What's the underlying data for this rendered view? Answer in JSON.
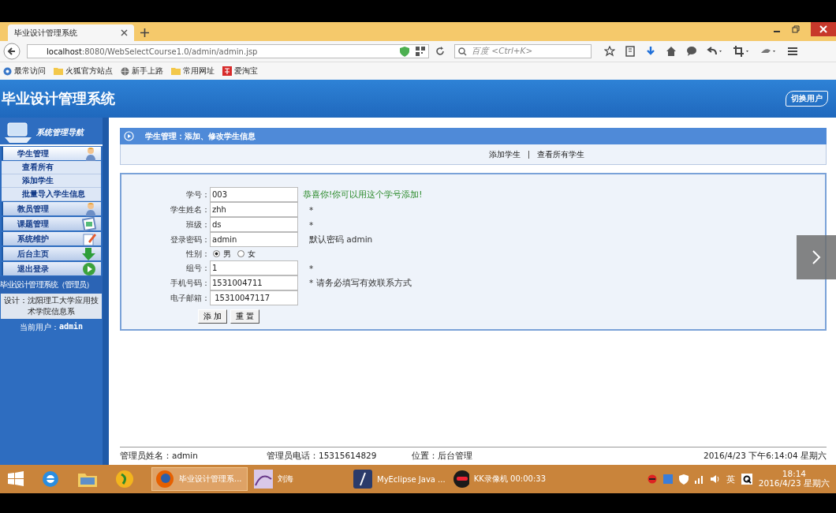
{
  "browser": {
    "tab_title": "毕业设计管理系统",
    "url_host": "localhost",
    "url_rest": ":8080/WebSelectCourse1.0/admin/admin.jsp",
    "search_placeholder": "百度 <Ctrl+K>",
    "bookmarks": [
      {
        "label": "最常访问",
        "kind": "gear"
      },
      {
        "label": "火狐官方站点",
        "kind": "folder"
      },
      {
        "label": "新手上路",
        "kind": "globe"
      },
      {
        "label": "常用网址",
        "kind": "folder"
      },
      {
        "label": "爱淘宝",
        "kind": "tao"
      }
    ]
  },
  "header": {
    "title": "毕业设计管理系统",
    "switch_user": "切换用户"
  },
  "sidebar": {
    "title": "系统管理导航",
    "menus": [
      {
        "label": "学生管理",
        "expanded": true,
        "children": [
          {
            "label": "查看所有"
          },
          {
            "label": "添加学生"
          },
          {
            "label": "批量导入学生信息"
          }
        ]
      },
      {
        "label": "教员管理",
        "expanded": false
      },
      {
        "label": "课题管理",
        "expanded": false
      },
      {
        "label": "系统维护",
        "expanded": false
      },
      {
        "label": "后台主页",
        "expanded": false
      },
      {
        "label": "退出登录",
        "expanded": false
      }
    ],
    "system_name": "毕业设计管理系统（管理员）",
    "design": "设计：沈阳理工大学应用技术学院信息系",
    "current_user_label": "当前用户：",
    "current_user": "admin"
  },
  "panel": {
    "title": "学生管理：添加、修改学生信息",
    "links": [
      "添加学生",
      "查看所有学生"
    ]
  },
  "form": {
    "fields": [
      {
        "label": "学号：",
        "kind": "text",
        "value": "003",
        "note": "恭喜你!你可以用这个学号添加!",
        "success": true
      },
      {
        "label": "学生姓名：",
        "kind": "text",
        "value": "zhh",
        "note": "*",
        "success": false
      },
      {
        "label": "班级：",
        "kind": "text",
        "value": "ds",
        "note": "*",
        "success": false
      },
      {
        "label": "登录密码：",
        "kind": "text",
        "value": "admin",
        "note": "默认密码 admin",
        "success": false
      },
      {
        "label": "性别：",
        "kind": "radio",
        "options": [
          {
            "label": "男",
            "selected": true
          },
          {
            "label": "女",
            "selected": false
          }
        ]
      },
      {
        "label": "组号：",
        "kind": "text",
        "value": "1",
        "note": "*",
        "success": false
      },
      {
        "label": "手机号码：",
        "kind": "text",
        "value": "1531004711",
        "note": "* 请务必填写有效联系方式",
        "success": false
      },
      {
        "label": "电子邮箱：",
        "kind": "text",
        "value": " 15310047117"
      }
    ],
    "buttons": [
      "添 加",
      "重 置"
    ]
  },
  "footer": {
    "admin_name": "管理员姓名：admin",
    "admin_phone": "管理员电话：15315614829",
    "location": "位置：后台管理",
    "datetime": "2016/4/23 下午6:14:04 星期六"
  },
  "taskbar": {
    "windows": [
      {
        "label": "毕业设计管理系...",
        "selected": true,
        "kind": "firefox"
      },
      {
        "label": "刘海",
        "selected": false,
        "kind": "image"
      },
      {
        "label": "MyEclipse Java ...",
        "selected": false,
        "kind": "eclipse"
      },
      {
        "label": "KK录像机 00:00:33",
        "selected": false,
        "kind": "kk"
      }
    ],
    "ime": "英",
    "time": "18:14",
    "date": "2016/4/23 星期六"
  }
}
